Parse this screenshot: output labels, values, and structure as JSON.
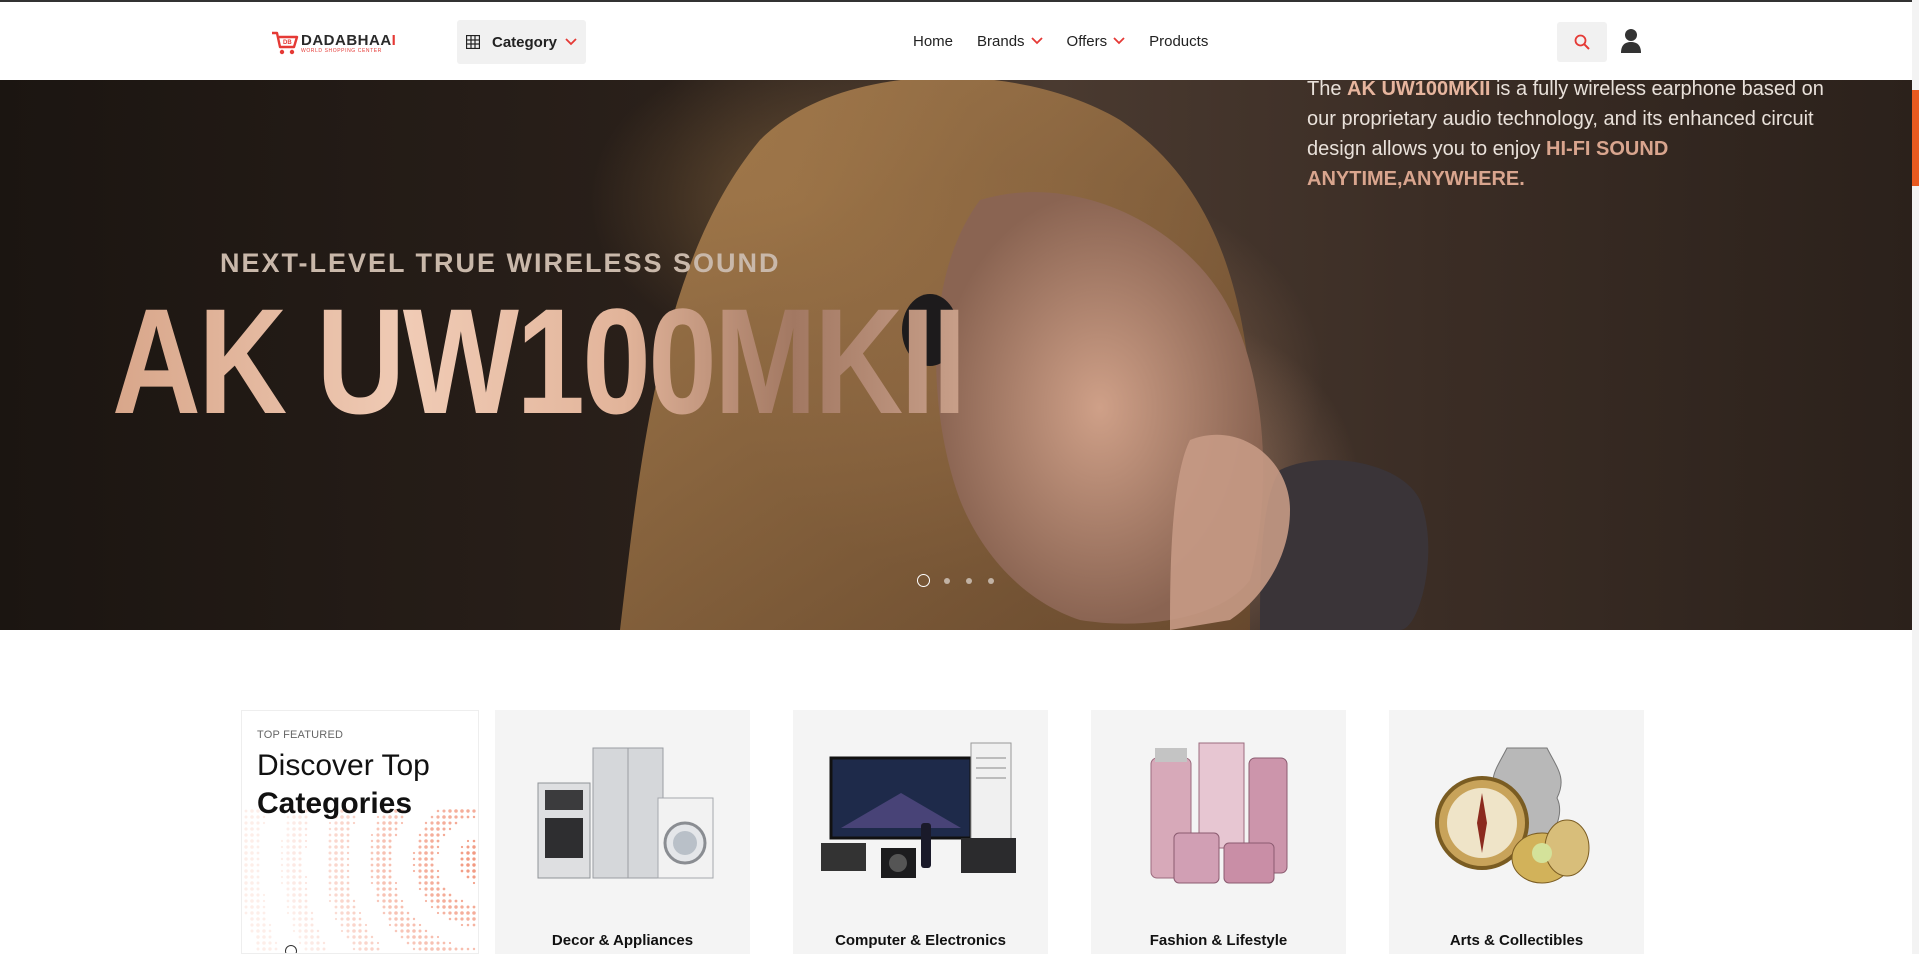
{
  "header": {
    "logo": {
      "name_main": "DADABHAA",
      "name_end": "I",
      "tagline": "WORLD SHOPPING CENTER"
    },
    "category_button": {
      "label": "Category"
    },
    "nav": [
      {
        "label": "Home",
        "has_dropdown": false
      },
      {
        "label": "Brands",
        "has_dropdown": true
      },
      {
        "label": "Offers",
        "has_dropdown": true
      },
      {
        "label": "Products",
        "has_dropdown": false
      }
    ],
    "icons": {
      "search": "search-icon",
      "user": "user-icon"
    }
  },
  "hero": {
    "subtitle": "NEXT-LEVEL TRUE WIRELESS SOUND",
    "title": "AK UW100MKII",
    "description": {
      "prefix": "The ",
      "product": "AK UW100MKII",
      "body": " is a fully wireless earphone based on our proprietary audio technology, and its enhanced circuit design allows you to enjoy ",
      "tagline": "HI-FI SOUND ANYTIME,ANYWHERE."
    },
    "slides": 4,
    "active_slide": 1
  },
  "categories": {
    "featured": {
      "eyebrow": "TOP FEATURED",
      "heading_line1": "Discover Top",
      "heading_line2": "Categories"
    },
    "items": [
      {
        "name": "Decor & Appliances",
        "icon": "appliances-image"
      },
      {
        "name": "Computer & Electronics",
        "icon": "electronics-image"
      },
      {
        "name": "Fashion & Lifestyle",
        "icon": "cosmetics-image"
      },
      {
        "name": "Arts & Collectibles",
        "icon": "collectibles-image"
      }
    ]
  },
  "colors": {
    "accent": "#e53935",
    "scroll_accent": "#e85a20",
    "card_bg": "#f4f4f4"
  }
}
